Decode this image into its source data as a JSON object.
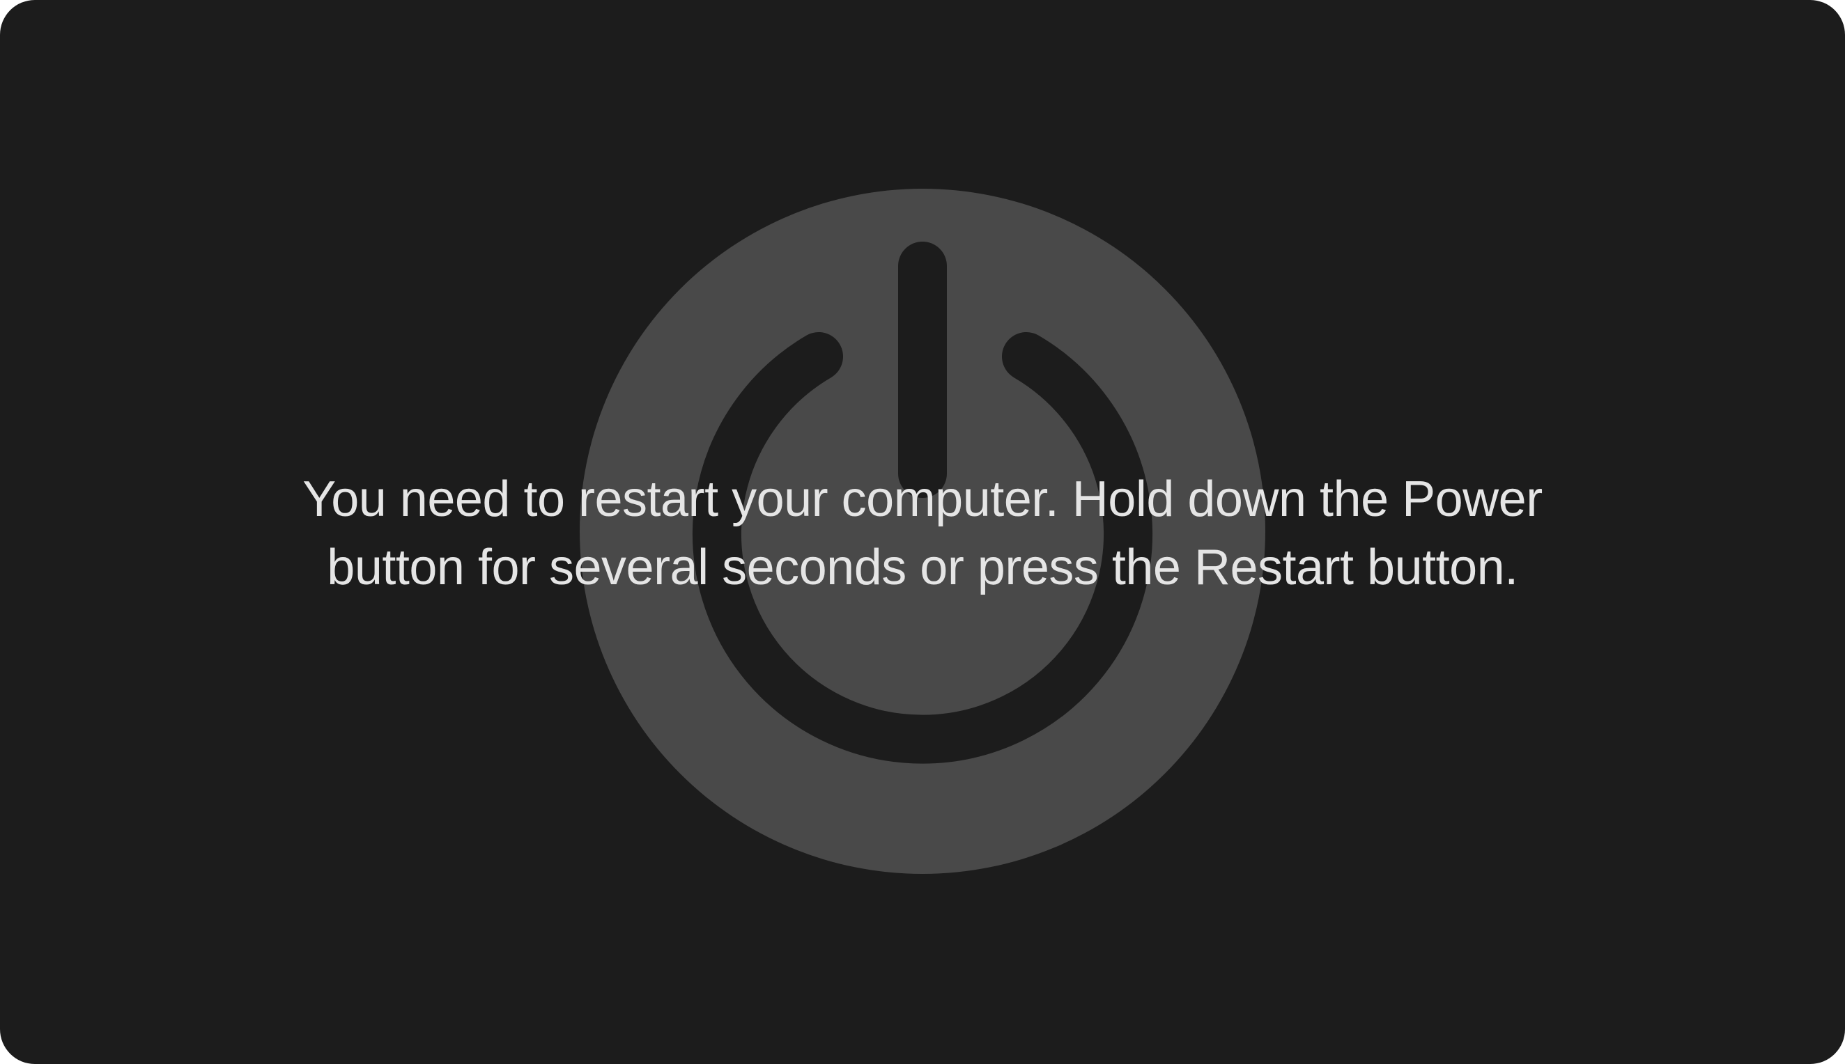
{
  "message": {
    "line1": "You need to restart your computer. Hold down the Power",
    "line2": "button for several seconds or press the Restart button."
  },
  "icon": "power-icon",
  "colors": {
    "background": "#1c1c1c",
    "circle": "#494949",
    "text": "#e5e5e5"
  }
}
